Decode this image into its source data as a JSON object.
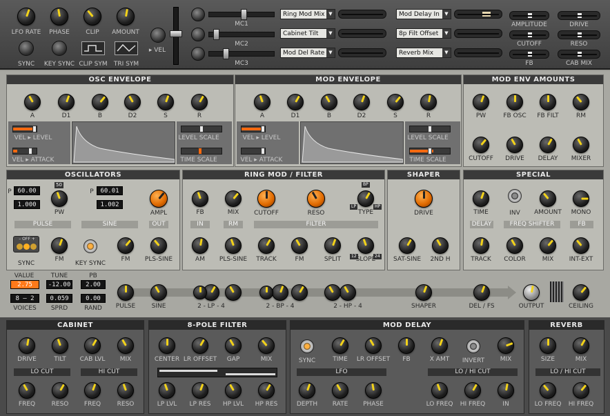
{
  "top": {
    "knobs": [
      "LFO RATE",
      "PHASE",
      "CLIP",
      "AMOUNT"
    ],
    "buttons": [
      "SYNC",
      "KEY SYNC",
      "CLIP SYM",
      "TRI SYM"
    ],
    "vel_label": "▸ VEL",
    "mc": [
      "MC1",
      "MC2",
      "MC3"
    ],
    "dropdowns_left": [
      "Ring Mod Mix",
      "Cabinet Tilt",
      "Mod Del Rate"
    ],
    "dropdowns_right": [
      "Mod Delay In",
      "8p Filt Offset",
      "Reverb Mix"
    ],
    "sliders": [
      "AMPLITUDE",
      "DRIVE",
      "CUTOFF",
      "RESO",
      "FB",
      "CAB MIX"
    ]
  },
  "osc_env": {
    "title": "OSC ENVELOPE",
    "knobs": [
      "A",
      "D1",
      "B",
      "D2",
      "S",
      "R"
    ],
    "vel_level": "VEL ▸ LEVEL",
    "vel_attack": "VEL ▸ ATTACK",
    "level_scale": "LEVEL SCALE",
    "time_scale": "TIME SCALE"
  },
  "mod_env": {
    "title": "MOD ENVELOPE",
    "knobs": [
      "A",
      "D1",
      "B",
      "D2",
      "S",
      "R"
    ],
    "vel_level": "VEL ▸ LEVEL",
    "vel_attack": "VEL ▸ ATTACK",
    "level_scale": "LEVEL SCALE",
    "time_scale": "TIME SCALE"
  },
  "mod_env_amounts": {
    "title": "MOD ENV AMOUNTS",
    "row1": [
      "PW",
      "FB OSC",
      "FB FILT",
      "RM"
    ],
    "row2": [
      "CUTOFF",
      "DRIVE",
      "DELAY",
      "MIXER"
    ]
  },
  "oscillators": {
    "title": "OSCILLATORS",
    "p1": "60.00",
    "r1": "1.000",
    "p2": "60.01",
    "r2": "1.002",
    "pw": "PW",
    "ampl": "AMPL",
    "pulse": "PULSE",
    "sine": "SINE",
    "out": "OUT",
    "sync": "SYNC",
    "fm1": "FM",
    "key_sync": "KEY SYNC",
    "fm2": "FM",
    "pls_sine": "PLS-SINE",
    "sync_sw": "– OFF +",
    "p_label": "P",
    "pw_tag": "50"
  },
  "ringmod": {
    "title": "RING MOD / FILTER",
    "row1": [
      "FB",
      "MIX",
      "CUTOFF",
      "RESO",
      "TYPE"
    ],
    "sections": [
      "IN",
      "RM",
      "FILTER"
    ],
    "row2": [
      "AM",
      "PLS-SINE",
      "TRACK",
      "FM",
      "SPLIT",
      "SLOPE"
    ],
    "type_tags": [
      "BP",
      "LP",
      "HP"
    ],
    "slope_tags": [
      "12",
      "24"
    ]
  },
  "shaper": {
    "title": "SHAPER",
    "drive": "DRIVE",
    "sat_sine": "SAT-SINE",
    "second_h": "2ND H"
  },
  "special": {
    "title": "SPECIAL",
    "row1": [
      "TIME",
      "INV",
      "AMOUNT",
      "MONO"
    ],
    "sections": [
      "DELAY",
      "FREQ SHIFTER",
      "FB"
    ],
    "row2": [
      "TRACK",
      "COLOR",
      "MIX",
      "INT-EXT"
    ]
  },
  "mixer": {
    "value_label": "VALUE",
    "value": "2.75",
    "tune_label": "TUNE",
    "tune": "-12.00",
    "pb_label": "PB",
    "pb": "2.00",
    "voices_disp": "8 – 2",
    "voices_label": "VOICES",
    "sprd": "0.059",
    "sprd_label": "SPRD",
    "rand": "0.00",
    "rand_label": "RAND",
    "knobs": [
      "PULSE",
      "SINE",
      "2 - LP - 4",
      "2 - BP - 4",
      "2 - HP - 4",
      "SHAPER",
      "DEL / FS",
      "OUTPUT",
      "CEILING"
    ]
  },
  "cabinet": {
    "title": "CABINET",
    "row1": [
      "DRIVE",
      "TILT",
      "CAB LVL",
      "MIX"
    ],
    "sections": [
      "LO CUT",
      "HI CUT"
    ],
    "row2": [
      "FREQ",
      "RESO",
      "FREQ",
      "RESO"
    ]
  },
  "pole8": {
    "title": "8-POLE FILTER",
    "row1": [
      "CENTER",
      "LR OFFSET",
      "GAP",
      "MIX"
    ],
    "row2": [
      "LP LVL",
      "LP RES",
      "HP LVL",
      "HP RES"
    ]
  },
  "moddelay": {
    "title": "MOD DELAY",
    "row1": [
      "SYNC",
      "TIME",
      "LR OFFSET",
      "FB",
      "X AMT",
      "INVERT",
      "MIX"
    ],
    "sections": [
      "LFO",
      "LO / HI CUT"
    ],
    "row2": [
      "DEPTH",
      "RATE",
      "PHASE",
      "LO FREQ",
      "HI FREQ",
      "IN"
    ]
  },
  "reverb": {
    "title": "REVERB",
    "row1": [
      "SIZE",
      "MIX"
    ],
    "sections": [
      "LO / HI CUT"
    ],
    "row2": [
      "LO FREQ",
      "HI FREQ"
    ]
  },
  "colors": {
    "accent": "#ff7a1a",
    "indicator": "#f2d21a",
    "panel": "#bcbcb5"
  }
}
